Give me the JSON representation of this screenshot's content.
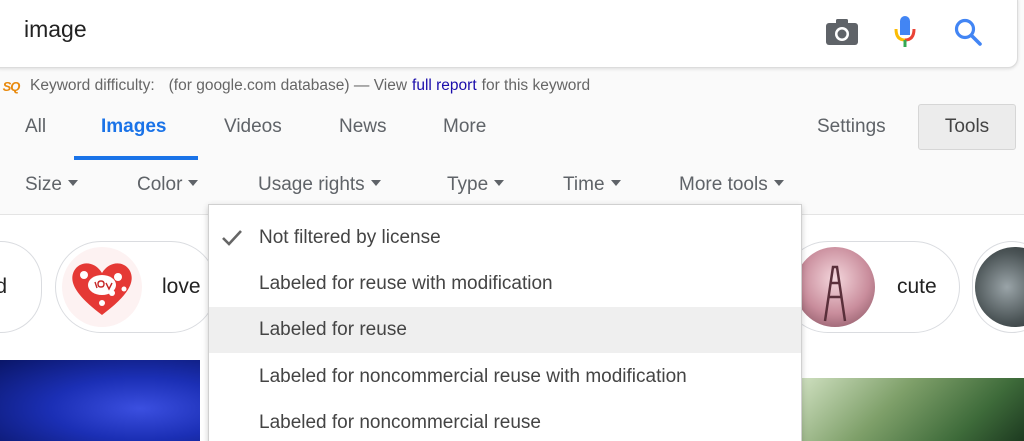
{
  "search": {
    "query": "image"
  },
  "keyword_bar": {
    "logo_text": "SQ",
    "prefix": "Keyword difficulty:",
    "database_note": "(for google.com database) — View",
    "link_text": "full report",
    "suffix": "for this keyword"
  },
  "tabs": {
    "all": "All",
    "images": "Images",
    "videos": "Videos",
    "news": "News",
    "more": "More",
    "settings": "Settings",
    "tools": "Tools"
  },
  "filters": {
    "size": "Size",
    "color": "Color",
    "usage_rights": "Usage rights",
    "type": "Type",
    "time": "Time",
    "more_tools": "More tools"
  },
  "chips": {
    "partial_left": "d",
    "love": "love",
    "cute": "cute"
  },
  "usage_menu": {
    "items": [
      "Not filtered by license",
      "Labeled for reuse with modification",
      "Labeled for reuse",
      "Labeled for noncommercial reuse with modification",
      "Labeled for noncommercial reuse"
    ],
    "checked_index": 0,
    "hovered_index": 2
  },
  "colors": {
    "active_tab": "#1a73e8",
    "link": "#1a0dab"
  }
}
